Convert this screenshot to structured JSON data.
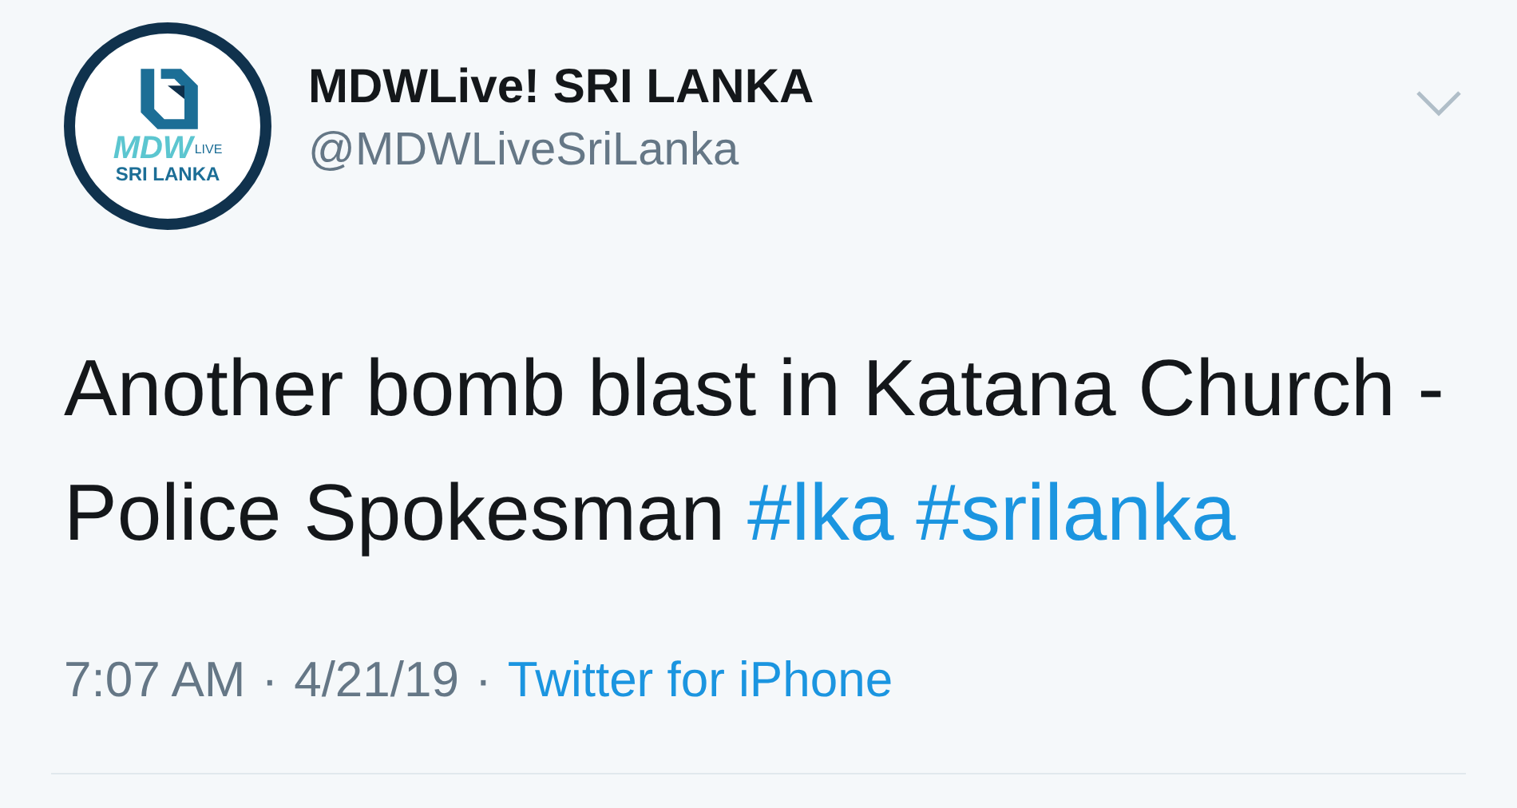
{
  "tweet": {
    "avatar": {
      "logo_mark": "MDW",
      "logo_badge": "LIVE",
      "logo_caption": "SRI LANKA"
    },
    "display_name": "MDWLive! SRI LANKA",
    "handle": "@MDWLiveSriLanka",
    "text": [
      {
        "kind": "plain",
        "text": "Another bomb blast in Katana Church - Police Spokesman"
      },
      {
        "kind": "hashtag",
        "text": "#lka"
      },
      {
        "kind": "hashtag",
        "text": "#srilanka"
      }
    ],
    "time": "7:07 AM",
    "separator": "·",
    "date": "4/21/19",
    "separator_2": "·",
    "source": "Twitter for iPhone"
  }
}
